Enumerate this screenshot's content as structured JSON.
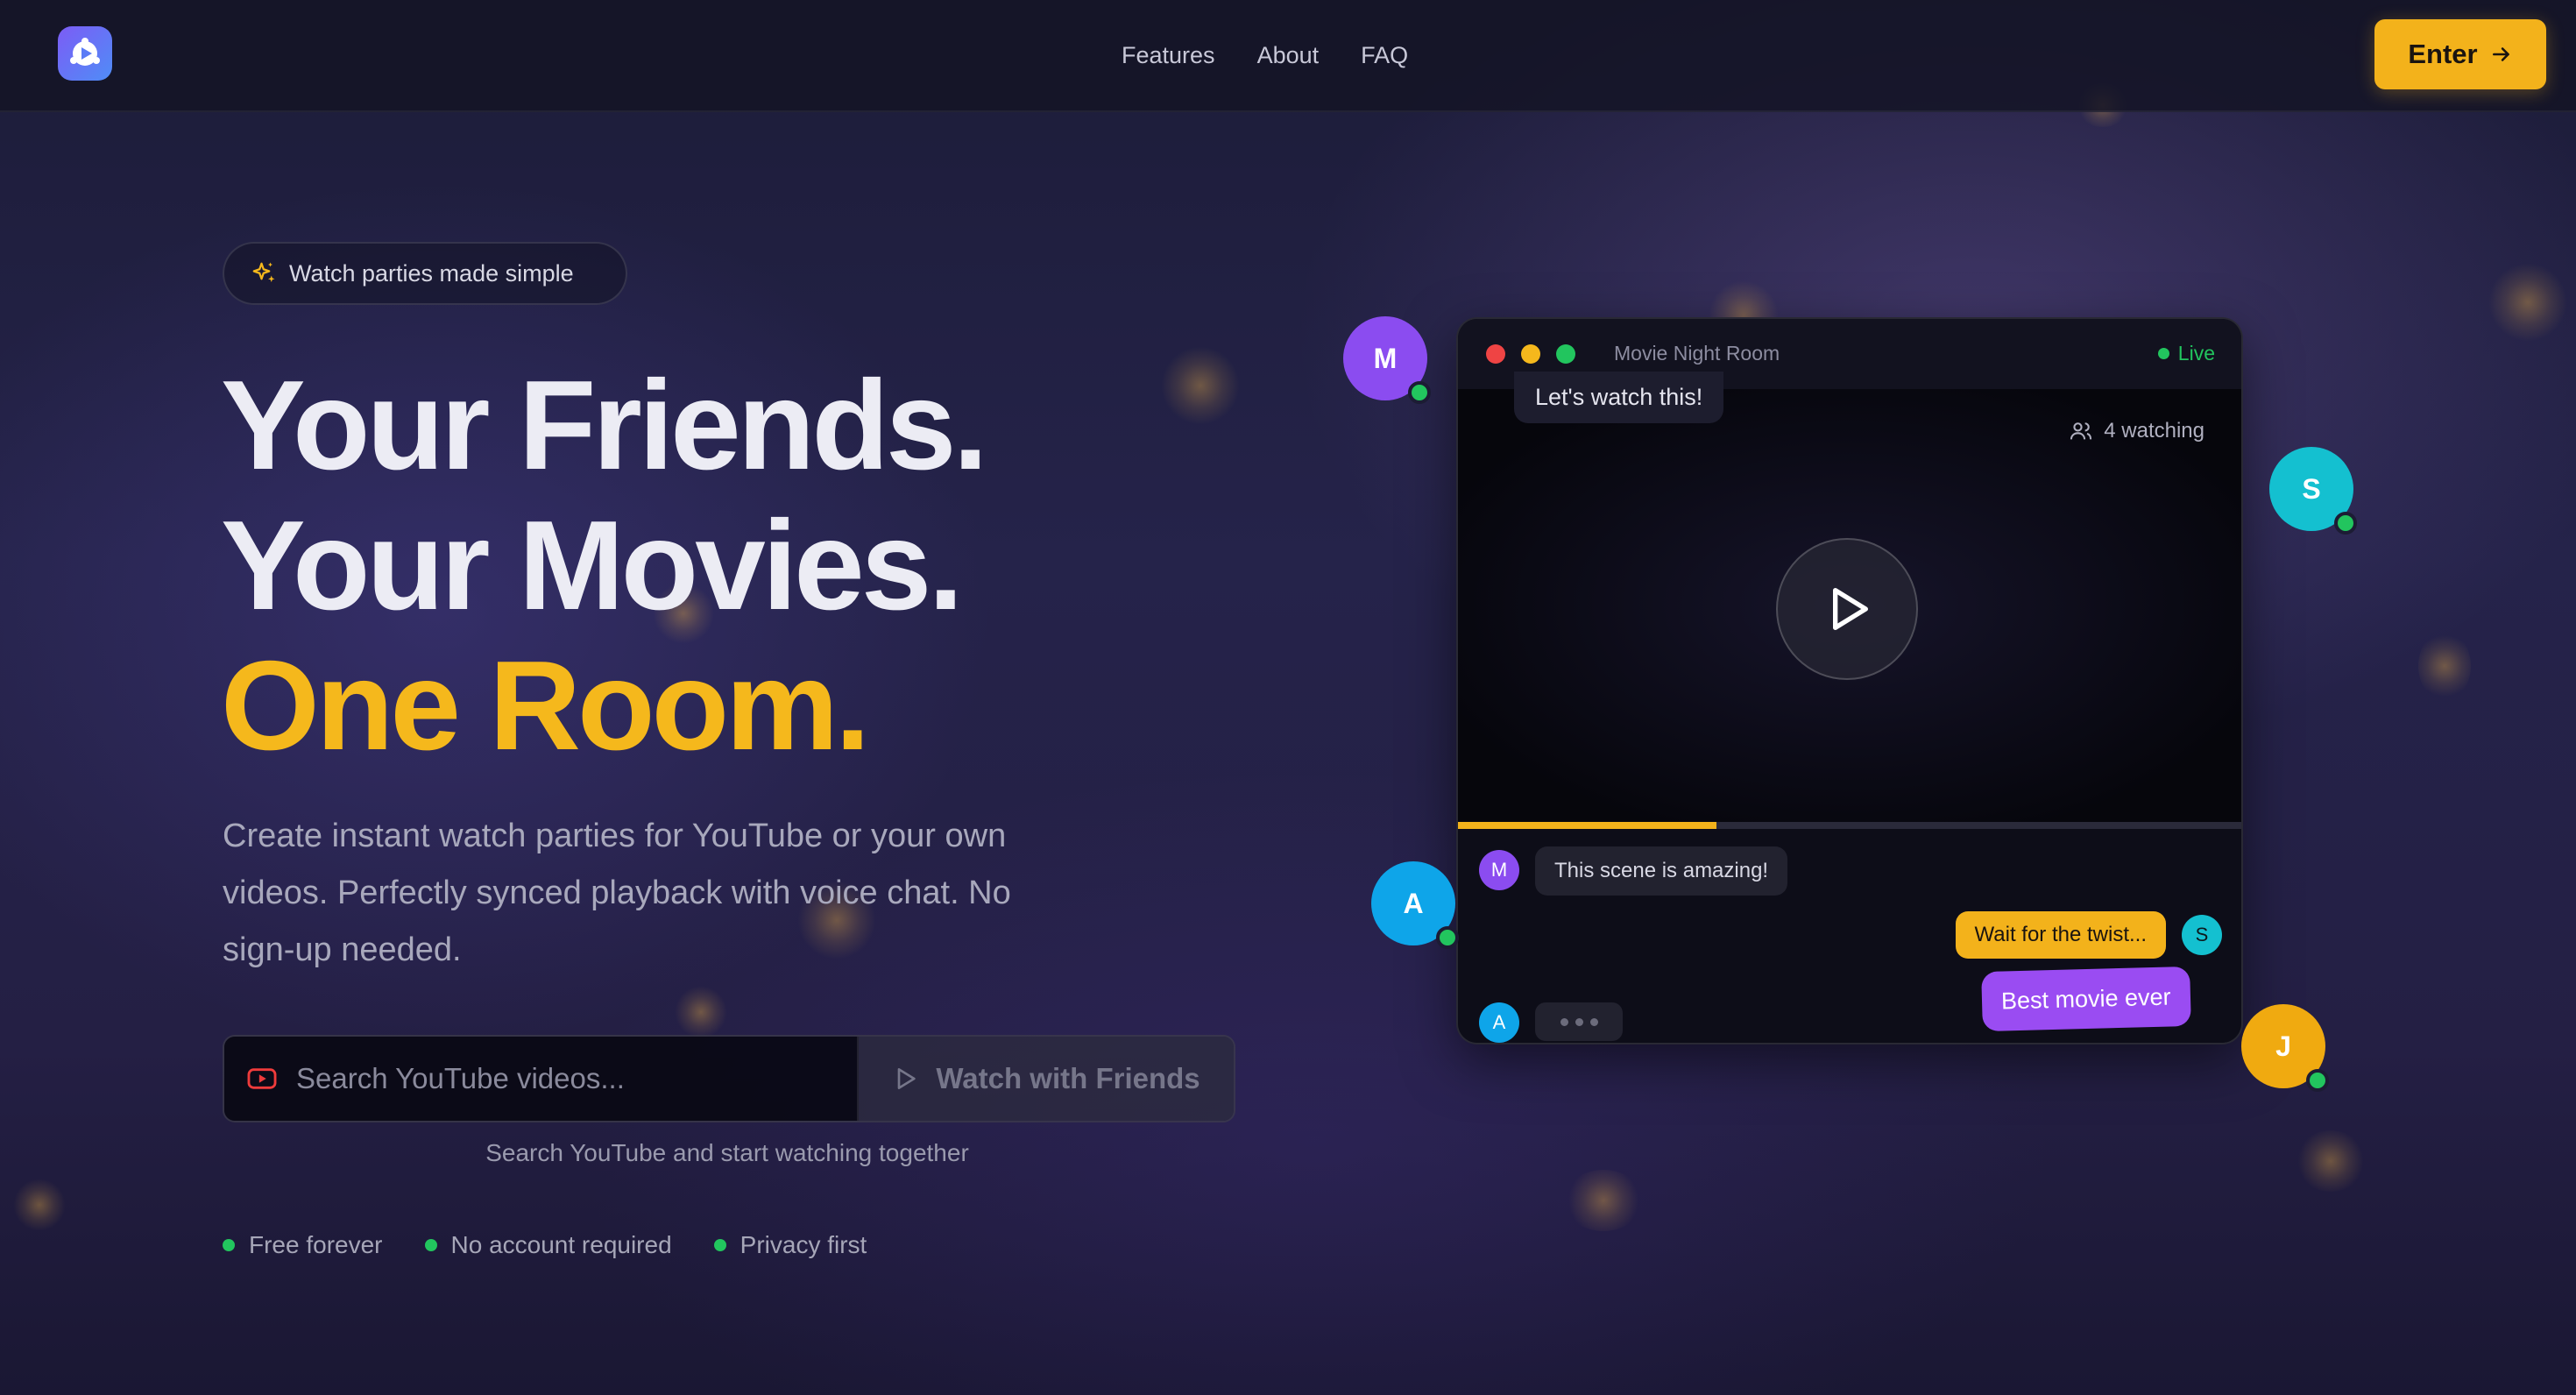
{
  "nav": {
    "links": [
      "Features",
      "About",
      "FAQ"
    ],
    "enter_label": "Enter"
  },
  "hero": {
    "badge": "Watch parties made simple",
    "headline_line1": "Your Friends.",
    "headline_line2": "Your Movies.",
    "headline_line3": "One Room.",
    "subtext": "Create instant watch parties for YouTube or your own videos. Perfectly synced playback with voice chat. No sign-up needed.",
    "search_placeholder": "Search YouTube videos...",
    "watch_button": "Watch with Friends",
    "search_hint": "Search YouTube and start watching together",
    "features": [
      "Free forever",
      "No account required",
      "Privacy first"
    ]
  },
  "mock": {
    "room_title": "Movie Night Room",
    "live_label": "Live",
    "watching": "4 watching",
    "progress": 0.33,
    "tooltip": "Let's watch this!",
    "chat": [
      {
        "initial": "M",
        "text": "This scene is amazing!"
      },
      {
        "initial": "S",
        "text": "Wait for the twist..."
      },
      {
        "text": "Best movie ever"
      },
      {
        "initial": "A"
      }
    ]
  },
  "avatars": [
    "M",
    "S",
    "A",
    "J"
  ],
  "colors": {
    "accent": "#f3b21b",
    "purple": "#8b4cf0",
    "cyan": "#14c0d0",
    "blue": "#0ea5e9",
    "online": "#22c55e"
  }
}
